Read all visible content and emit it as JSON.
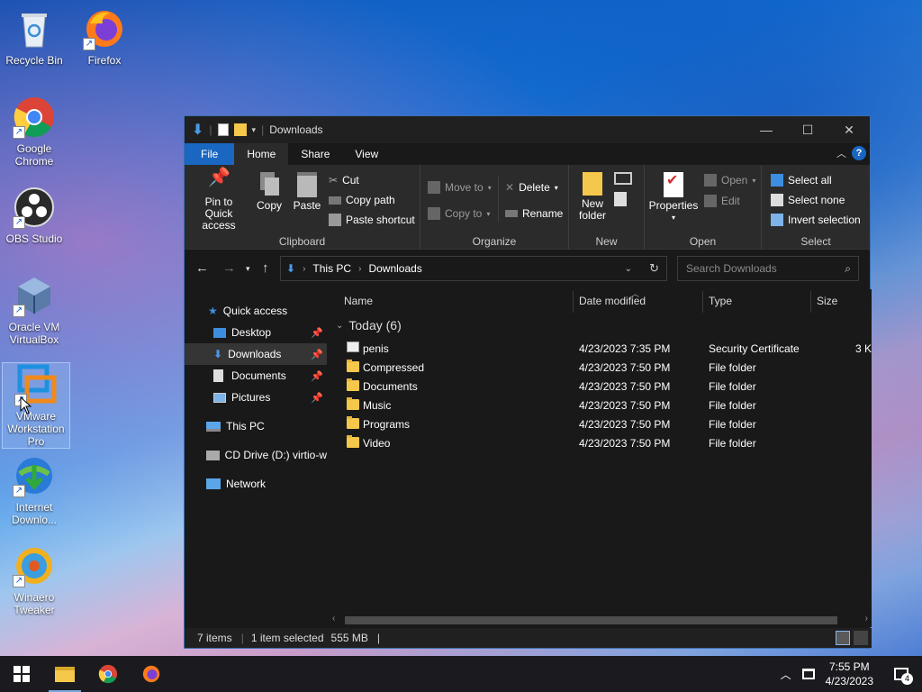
{
  "desktop": {
    "icons": [
      {
        "label": "Recycle Bin"
      },
      {
        "label": "Firefox"
      },
      {
        "label": "Google Chrome"
      },
      {
        "label": "OBS Studio"
      },
      {
        "label": "Oracle VM VirtualBox"
      },
      {
        "label": "VMware Workstation Pro"
      },
      {
        "label": "Internet Downlo..."
      },
      {
        "label": "Winaero Tweaker"
      }
    ]
  },
  "window": {
    "title": "Downloads",
    "ribbon_tabs": [
      "File",
      "Home",
      "Share",
      "View"
    ],
    "active_tab": "Home",
    "clipboard": {
      "label": "Clipboard",
      "pin": "Pin to Quick access",
      "copy": "Copy",
      "paste": "Paste",
      "cut": "Cut",
      "copy_path": "Copy path",
      "paste_shortcut": "Paste shortcut"
    },
    "organize": {
      "label": "Organize",
      "move_to": "Move to",
      "copy_to": "Copy to",
      "delete": "Delete",
      "rename": "Rename"
    },
    "new": {
      "label": "New",
      "new_folder": "New folder"
    },
    "open": {
      "label": "Open",
      "properties": "Properties",
      "open": "Open",
      "edit": "Edit"
    },
    "select": {
      "label": "Select",
      "select_all": "Select all",
      "select_none": "Select none",
      "invert": "Invert selection"
    },
    "address": {
      "crumbs": [
        "This PC",
        "Downloads"
      ],
      "search_placeholder": "Search Downloads"
    },
    "nav": {
      "quick_access": "Quick access",
      "desktop": "Desktop",
      "downloads": "Downloads",
      "documents": "Documents",
      "pictures": "Pictures",
      "this_pc": "This PC",
      "cd_drive": "CD Drive (D:) virtio-w",
      "network": "Network"
    },
    "columns": {
      "name": "Name",
      "date": "Date modified",
      "type": "Type",
      "size": "Size"
    },
    "group_title": "Today (6)",
    "files": [
      {
        "name": "penis",
        "date": "4/23/2023 7:35 PM",
        "type": "Security Certificate",
        "size": "3 K",
        "icon": "certificate-icon"
      },
      {
        "name": "Compressed",
        "date": "4/23/2023 7:50 PM",
        "type": "File folder",
        "size": "",
        "icon": "folder-icon"
      },
      {
        "name": "Documents",
        "date": "4/23/2023 7:50 PM",
        "type": "File folder",
        "size": "",
        "icon": "folder-icon"
      },
      {
        "name": "Music",
        "date": "4/23/2023 7:50 PM",
        "type": "File folder",
        "size": "",
        "icon": "folder-icon"
      },
      {
        "name": "Programs",
        "date": "4/23/2023 7:50 PM",
        "type": "File folder",
        "size": "",
        "icon": "folder-icon"
      },
      {
        "name": "Video",
        "date": "4/23/2023 7:50 PM",
        "type": "File folder",
        "size": "",
        "icon": "folder-icon"
      }
    ],
    "status": {
      "items": "7 items",
      "selected": "1 item selected",
      "size": "555 MB"
    }
  },
  "taskbar": {
    "time": "7:55 PM",
    "date": "4/23/2023",
    "notifications": "4"
  },
  "colors": {
    "accent": "#1a67c2",
    "window_bg": "#191919",
    "ribbon_bg": "#2b2b2b",
    "folder": "#f5c84b"
  }
}
